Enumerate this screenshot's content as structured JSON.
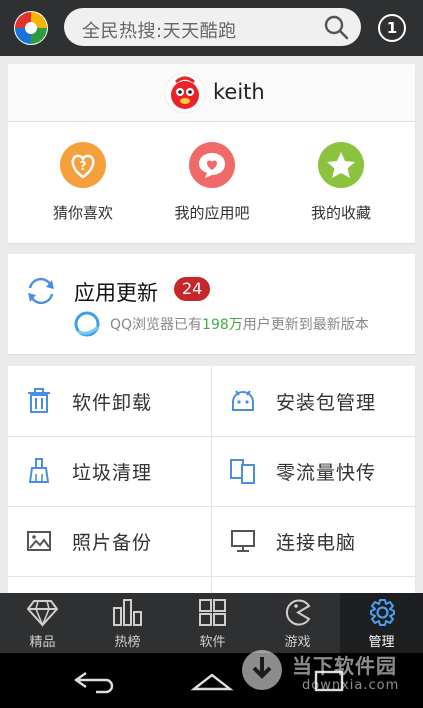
{
  "header": {
    "search_placeholder": "全民热搜:天天酷跑",
    "notification_count": "1"
  },
  "user": {
    "name": "keith"
  },
  "quick_links": [
    {
      "label": "猜你喜欢",
      "icon": "question-heart-icon",
      "color": "#f5a03b"
    },
    {
      "label": "我的应用吧",
      "icon": "chat-heart-icon",
      "color": "#f06a6a"
    },
    {
      "label": "我的收藏",
      "icon": "star-icon",
      "color": "#8cc23e"
    }
  ],
  "update": {
    "title": "应用更新",
    "badge": "24",
    "sub_before": "QQ浏览器已有",
    "sub_highlight": "198万",
    "sub_after": "用户更新到最新版本"
  },
  "tools": [
    {
      "label": "软件卸载",
      "icon": "trash-icon"
    },
    {
      "label": "安装包管理",
      "icon": "android-icon"
    },
    {
      "label": "垃圾清理",
      "icon": "broom-icon"
    },
    {
      "label": "零流量快传",
      "icon": "phone-transfer-icon"
    },
    {
      "label": "照片备份",
      "icon": "photo-icon"
    },
    {
      "label": "连接电脑",
      "icon": "monitor-icon"
    }
  ],
  "nav": [
    {
      "label": "精品",
      "icon": "diamond-icon"
    },
    {
      "label": "热榜",
      "icon": "bar-chart-icon"
    },
    {
      "label": "软件",
      "icon": "grid-icon"
    },
    {
      "label": "游戏",
      "icon": "pacman-icon"
    },
    {
      "label": "管理",
      "icon": "gear-icon",
      "active": true
    }
  ],
  "watermark": {
    "text": "当下软件园",
    "sub": "downxia.com"
  },
  "colors": {
    "accent": "#4a8fe0",
    "bar": "#2f3032",
    "badge": "#c5272b",
    "highlight": "#49a94a"
  }
}
